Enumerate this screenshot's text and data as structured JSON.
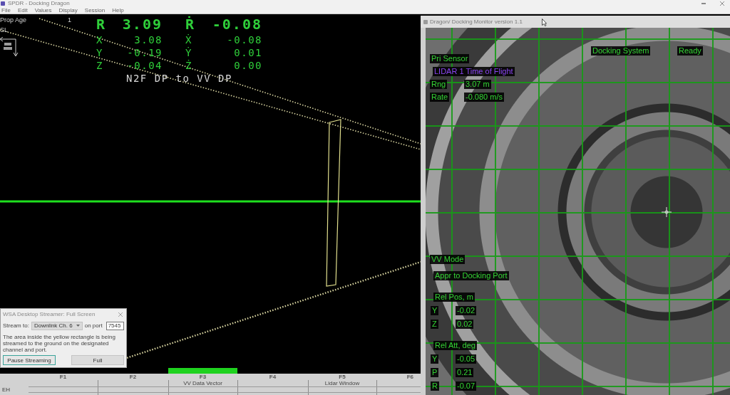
{
  "app_window": {
    "title": "SPDR - Docking Dragon",
    "menu": [
      {
        "label": "File"
      },
      {
        "label": "Edit"
      },
      {
        "label": "Values"
      },
      {
        "label": "Display"
      },
      {
        "label": "Session"
      },
      {
        "label": "Help"
      }
    ]
  },
  "nav_display": {
    "prop_age": {
      "label": "Prop Age",
      "value": "1"
    },
    "frame": "SL",
    "range": {
      "label": "R",
      "value": "3.09"
    },
    "range_rate": {
      "label": "Ṙ",
      "value": "-0.08"
    },
    "position": [
      {
        "label": "X",
        "value": "3.08"
      },
      {
        "label": "Y",
        "value": "-0.19"
      },
      {
        "label": "Z",
        "value": "-0.04"
      }
    ],
    "velocity": [
      {
        "label": "Ẋ",
        "value": "-0.08"
      },
      {
        "label": "Ẏ",
        "value": "0.01"
      },
      {
        "label": "Ż",
        "value": "0.00"
      }
    ],
    "reference": "N2F DP to VV DP"
  },
  "function_keys": {
    "side_label": "EH",
    "keys": [
      {
        "key": "F1",
        "selected": false
      },
      {
        "key": "F2",
        "selected": false
      },
      {
        "key": "F3",
        "label": "VV Data Vector",
        "selected": true
      },
      {
        "key": "F4",
        "selected": false
      },
      {
        "key": "F5",
        "label": "Lidar Window",
        "selected": false
      },
      {
        "key": "F6",
        "selected": false
      }
    ]
  },
  "streamer_dialog": {
    "title": "WSA Desktop Streamer: Full Screen",
    "stream_to": {
      "label": "Stream to:",
      "value": "Downlink Ch. 6"
    },
    "port": {
      "label": "on port",
      "value": "7545"
    },
    "description": "The area inside the yellow rectangle is being streamed to the ground on the designated channel and port.",
    "buttons": [
      {
        "label": "Pause Streaming",
        "focused": true
      },
      {
        "label": "Full",
        "focused": false
      }
    ]
  },
  "monitor_window": {
    "title": "Dragon/ Docking Monitor version 1.1",
    "primary_sensor": {
      "heading": "Pri Sensor",
      "sensor": "LIDAR 1 Time of Flight",
      "readings": [
        {
          "label": "Rng",
          "value": "3.07 m"
        },
        {
          "label": "Rate",
          "value": "-0.080 m/s"
        }
      ]
    },
    "docking_system": {
      "label": "Docking System",
      "status": "Ready"
    },
    "vv_mode": {
      "heading": "VV Mode",
      "mode": "Appr to Docking Port",
      "sections": [
        {
          "heading": "Rel Pos, m",
          "rows": [
            {
              "label": "Y",
              "value": "-0.02"
            },
            {
              "label": "Z",
              "value": "0.02"
            }
          ]
        },
        {
          "heading": "Rel Att, deg",
          "rows": [
            {
              "label": "Y",
              "value": "-0.05"
            },
            {
              "label": "P",
              "value": "0.21"
            },
            {
              "label": "R",
              "value": "-0.07"
            }
          ]
        }
      ]
    }
  }
}
